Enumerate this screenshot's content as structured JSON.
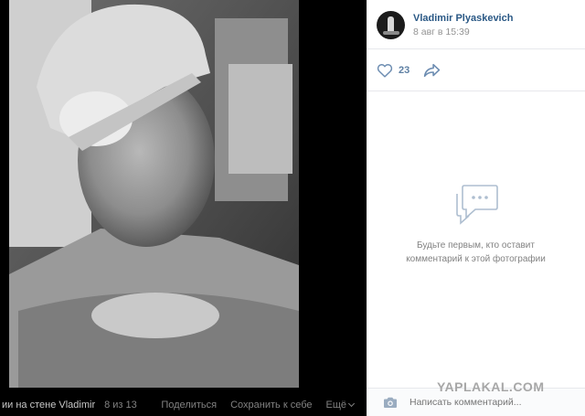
{
  "viewer": {
    "album_title": "ии на стене Vladimir",
    "counter": "8 из 13",
    "actions": {
      "share": "Поделиться",
      "save": "Сохранить к себе",
      "more": "Ещё"
    }
  },
  "post": {
    "author": "Vladimir Plyaskevich",
    "date": "8 авг в 15:39",
    "likes": "23",
    "empty_comments": {
      "line1": "Будьте первым, кто оставит",
      "line2": "комментарий к этой фотографии"
    },
    "comment_placeholder": "Написать комментарий..."
  },
  "colors": {
    "link": "#2a5885",
    "muted": "#828282",
    "like_count": "#5d7fa3"
  },
  "icons": {
    "like": "heart-icon",
    "share": "share-arrow-icon",
    "empty": "speech-bubble-icon",
    "attach": "camera-icon"
  },
  "watermark": "YAPLAKAL.COM"
}
